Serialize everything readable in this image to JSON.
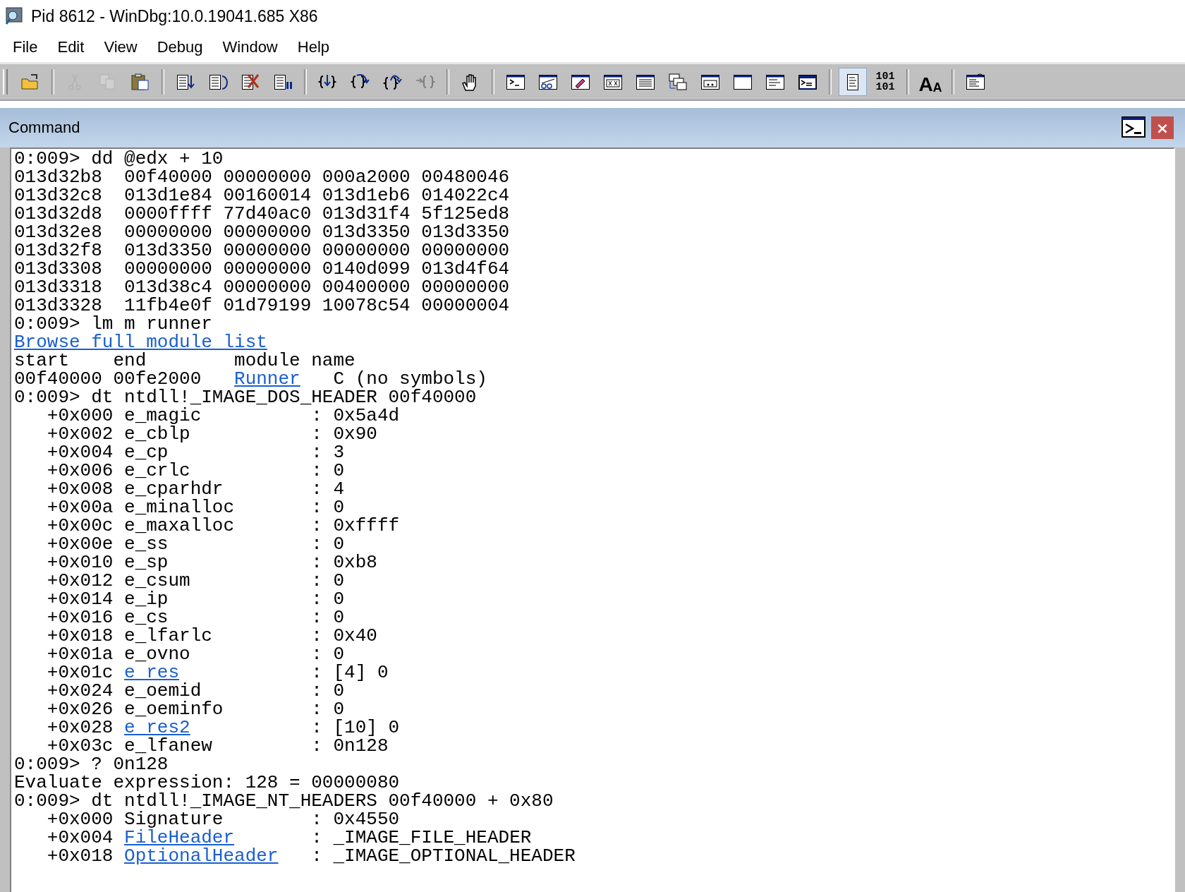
{
  "window": {
    "title": "Pid 8612 - WinDbg:10.0.19041.685 X86"
  },
  "menu": [
    "File",
    "Edit",
    "View",
    "Debug",
    "Window",
    "Help"
  ],
  "toolbar": [
    [
      {
        "kind": "open",
        "disabled": false,
        "pressed": false
      }
    ],
    [
      {
        "kind": "cut",
        "disabled": true,
        "pressed": false
      },
      {
        "kind": "copy",
        "disabled": true,
        "pressed": false
      },
      {
        "kind": "paste",
        "disabled": false,
        "pressed": false
      }
    ],
    [
      {
        "kind": "go",
        "disabled": false,
        "pressed": false
      },
      {
        "kind": "restart",
        "disabled": false,
        "pressed": false
      },
      {
        "kind": "stop",
        "disabled": false,
        "pressed": false
      },
      {
        "kind": "break",
        "disabled": false,
        "pressed": false
      }
    ],
    [
      {
        "kind": "step-into",
        "disabled": false,
        "pressed": false
      },
      {
        "kind": "step-over",
        "disabled": false,
        "pressed": false
      },
      {
        "kind": "step-out",
        "disabled": false,
        "pressed": false
      },
      {
        "kind": "run-to-cursor",
        "disabled": true,
        "pressed": false
      }
    ],
    [
      {
        "kind": "hand",
        "disabled": false,
        "pressed": false
      }
    ],
    [
      {
        "kind": "command",
        "disabled": false,
        "pressed": false
      },
      {
        "kind": "watch",
        "disabled": false,
        "pressed": false
      },
      {
        "kind": "locals",
        "disabled": false,
        "pressed": false
      },
      {
        "kind": "registers",
        "disabled": false,
        "pressed": false
      },
      {
        "kind": "memory",
        "disabled": false,
        "pressed": false
      },
      {
        "kind": "callstack",
        "disabled": false,
        "pressed": false
      },
      {
        "kind": "disassembly",
        "disabled": false,
        "pressed": false
      },
      {
        "kind": "scratch",
        "disabled": false,
        "pressed": false
      },
      {
        "kind": "processes",
        "disabled": false,
        "pressed": false
      },
      {
        "kind": "browser",
        "disabled": false,
        "pressed": false
      }
    ],
    [
      {
        "kind": "source-mode",
        "disabled": false,
        "pressed": true
      },
      {
        "kind": "binary",
        "disabled": false,
        "pressed": false,
        "labels": [
          "101",
          "101"
        ]
      }
    ],
    [
      {
        "kind": "font",
        "disabled": false,
        "pressed": false,
        "labels": [
          "A",
          "A"
        ]
      }
    ],
    [
      {
        "kind": "options",
        "disabled": false,
        "pressed": false
      }
    ]
  ],
  "pane": {
    "title": "Command",
    "close": "×",
    "lines": [
      [
        {
          "text": "0:009> dd @edx + 10",
          "kind": "plain"
        }
      ],
      [
        {
          "text": "013d32b8  00f40000 00000000 000a2000 00480046",
          "kind": "plain"
        }
      ],
      [
        {
          "text": "013d32c8  013d1e84 00160014 013d1eb6 014022c4",
          "kind": "plain"
        }
      ],
      [
        {
          "text": "013d32d8  0000ffff 77d40ac0 013d31f4 5f125ed8",
          "kind": "plain"
        }
      ],
      [
        {
          "text": "013d32e8  00000000 00000000 013d3350 013d3350",
          "kind": "plain"
        }
      ],
      [
        {
          "text": "013d32f8  013d3350 00000000 00000000 00000000",
          "kind": "plain"
        }
      ],
      [
        {
          "text": "013d3308  00000000 00000000 0140d099 013d4f64",
          "kind": "plain"
        }
      ],
      [
        {
          "text": "013d3318  013d38c4 00000000 00400000 00000000",
          "kind": "plain"
        }
      ],
      [
        {
          "text": "013d3328  11fb4e0f 01d79199 10078c54 00000004",
          "kind": "plain"
        }
      ],
      [
        {
          "text": "0:009> lm m runner",
          "kind": "plain"
        }
      ],
      [
        {
          "text": "Browse full module list",
          "kind": "link"
        }
      ],
      [
        {
          "text": "start    end        module name",
          "kind": "plain"
        }
      ],
      [
        {
          "text": "00f40000 00fe2000   ",
          "kind": "plain"
        },
        {
          "text": "Runner",
          "kind": "link"
        },
        {
          "text": "   C (no symbols)",
          "kind": "plain"
        }
      ],
      [
        {
          "text": "0:009> dt ntdll!_IMAGE_DOS_HEADER 00f40000",
          "kind": "plain"
        }
      ],
      [
        {
          "text": "   +0x000 e_magic          : 0x5a4d",
          "kind": "plain"
        }
      ],
      [
        {
          "text": "   +0x002 e_cblp           : 0x90",
          "kind": "plain"
        }
      ],
      [
        {
          "text": "   +0x004 e_cp             : 3",
          "kind": "plain"
        }
      ],
      [
        {
          "text": "   +0x006 e_crlc           : 0",
          "kind": "plain"
        }
      ],
      [
        {
          "text": "   +0x008 e_cparhdr        : 4",
          "kind": "plain"
        }
      ],
      [
        {
          "text": "   +0x00a e_minalloc       : 0",
          "kind": "plain"
        }
      ],
      [
        {
          "text": "   +0x00c e_maxalloc       : 0xffff",
          "kind": "plain"
        }
      ],
      [
        {
          "text": "   +0x00e e_ss             : 0",
          "kind": "plain"
        }
      ],
      [
        {
          "text": "   +0x010 e_sp             : 0xb8",
          "kind": "plain"
        }
      ],
      [
        {
          "text": "   +0x012 e_csum           : 0",
          "kind": "plain"
        }
      ],
      [
        {
          "text": "   +0x014 e_ip             : 0",
          "kind": "plain"
        }
      ],
      [
        {
          "text": "   +0x016 e_cs             : 0",
          "kind": "plain"
        }
      ],
      [
        {
          "text": "   +0x018 e_lfarlc         : 0x40",
          "kind": "plain"
        }
      ],
      [
        {
          "text": "   +0x01a e_ovno           : 0",
          "kind": "plain"
        }
      ],
      [
        {
          "text": "   +0x01c ",
          "kind": "plain"
        },
        {
          "text": "e_res",
          "kind": "link"
        },
        {
          "text": "            : [4] 0",
          "kind": "plain"
        }
      ],
      [
        {
          "text": "   +0x024 e_oemid          : 0",
          "kind": "plain"
        }
      ],
      [
        {
          "text": "   +0x026 e_oeminfo        : 0",
          "kind": "plain"
        }
      ],
      [
        {
          "text": "   +0x028 ",
          "kind": "plain"
        },
        {
          "text": "e_res2",
          "kind": "link"
        },
        {
          "text": "           : [10] 0",
          "kind": "plain"
        }
      ],
      [
        {
          "text": "   +0x03c e_lfanew         : 0n128",
          "kind": "plain"
        }
      ],
      [
        {
          "text": "0:009> ? 0n128",
          "kind": "plain"
        }
      ],
      [
        {
          "text": "Evaluate expression: 128 = 00000080",
          "kind": "plain"
        }
      ],
      [
        {
          "text": "0:009> dt ntdll!_IMAGE_NT_HEADERS 00f40000 + 0x80",
          "kind": "plain"
        }
      ],
      [
        {
          "text": "   +0x000 Signature        : 0x4550",
          "kind": "plain"
        }
      ],
      [
        {
          "text": "   +0x004 ",
          "kind": "plain"
        },
        {
          "text": "FileHeader",
          "kind": "link"
        },
        {
          "text": "       : _IMAGE_FILE_HEADER",
          "kind": "plain"
        }
      ],
      [
        {
          "text": "   +0x018 ",
          "kind": "plain"
        },
        {
          "text": "OptionalHeader",
          "kind": "link"
        },
        {
          "text": "   : _IMAGE_OPTIONAL_HEADER",
          "kind": "plain"
        }
      ]
    ]
  }
}
